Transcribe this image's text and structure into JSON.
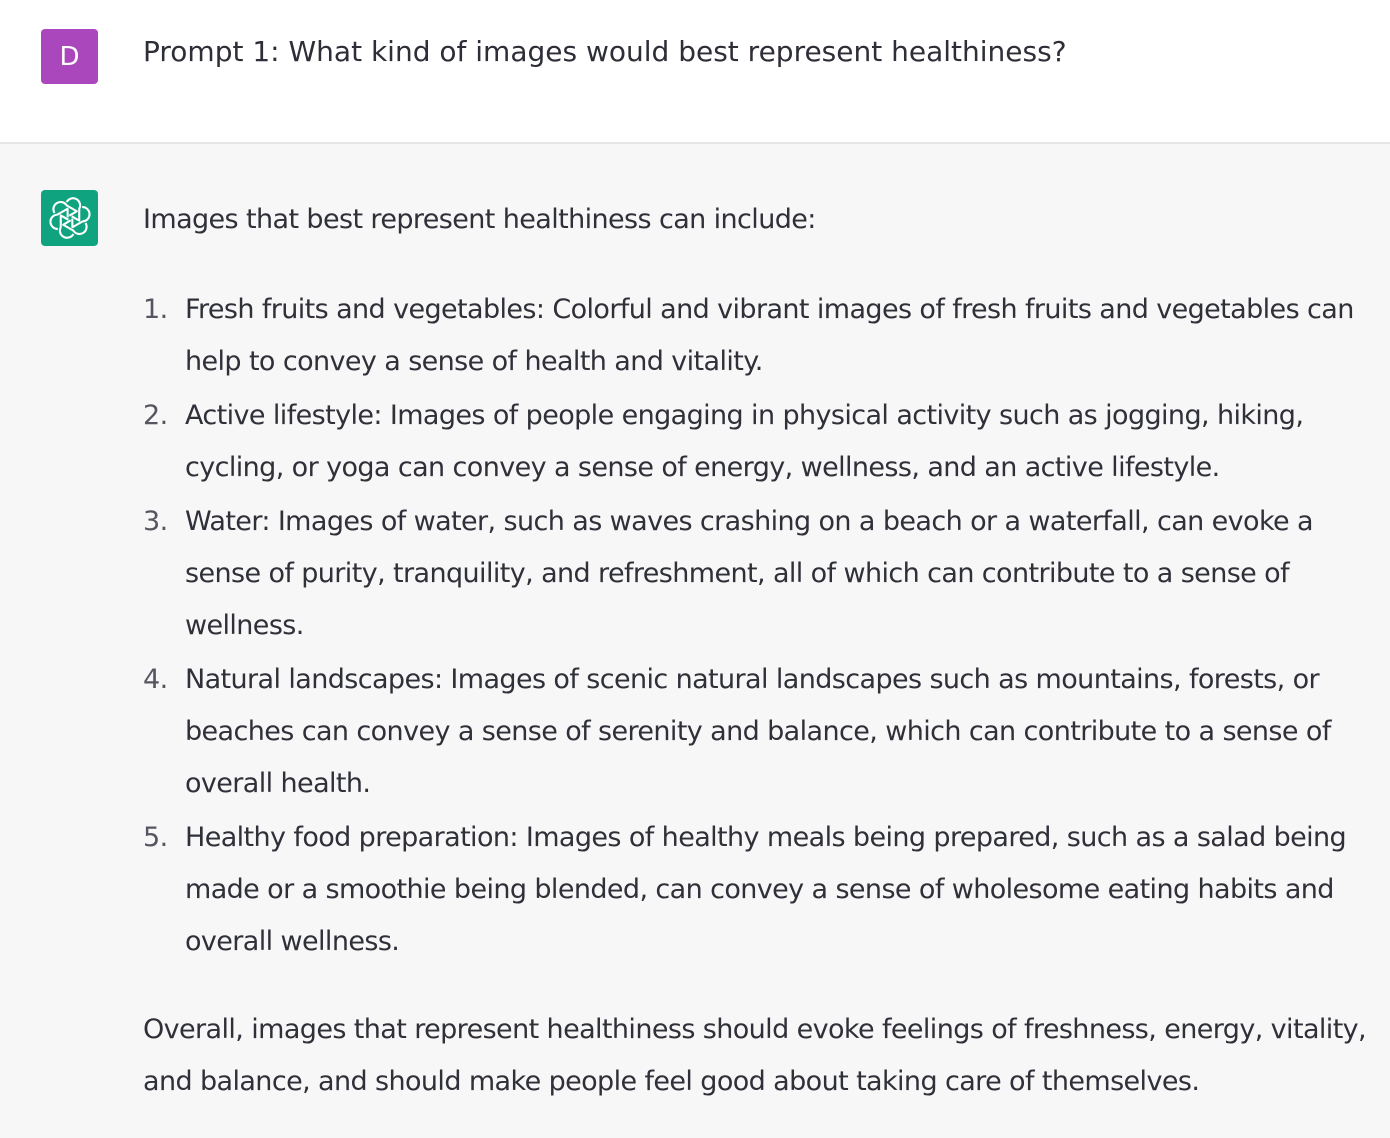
{
  "user_message": {
    "avatar_letter": "D",
    "text": "Prompt 1: What kind of images would best represent healthiness?"
  },
  "assistant_message": {
    "intro": "Images that best represent healthiness can include:",
    "items": [
      {
        "num": "1.",
        "text": "Fresh fruits and vegetables: Colorful and vibrant images of fresh fruits and vegetables can help to convey a sense of health and vitality."
      },
      {
        "num": "2.",
        "text": "Active lifestyle: Images of people engaging in physical activity such as jogging, hiking, cycling, or yoga can convey a sense of energy, wellness, and an active lifestyle."
      },
      {
        "num": "3.",
        "text": "Water: Images of water, such as waves crashing on a beach or a waterfall, can evoke a sense of purity, tranquility, and refreshment, all of which can contribute to a sense of wellness."
      },
      {
        "num": "4.",
        "text": "Natural landscapes: Images of scenic natural landscapes such as mountains, forests, or beaches can convey a sense of serenity and balance, which can contribute to a sense of overall health."
      },
      {
        "num": "5.",
        "text": "Healthy food preparation: Images of healthy meals being prepared, such as a salad being made or a smoothie being blended, can convey a sense of wholesome eating habits and overall wellness."
      }
    ],
    "conclusion": "Overall, images that represent healthiness should evoke feelings of freshness, energy, vitality, and balance, and should make people feel good about taking care of themselves."
  },
  "colors": {
    "user_avatar": "#ab47bc",
    "assistant_avatar": "#10a37f",
    "user_background": "#ffffff",
    "assistant_background": "#f7f7f8"
  },
  "icons": {
    "assistant_avatar": "openai-logo-icon"
  }
}
